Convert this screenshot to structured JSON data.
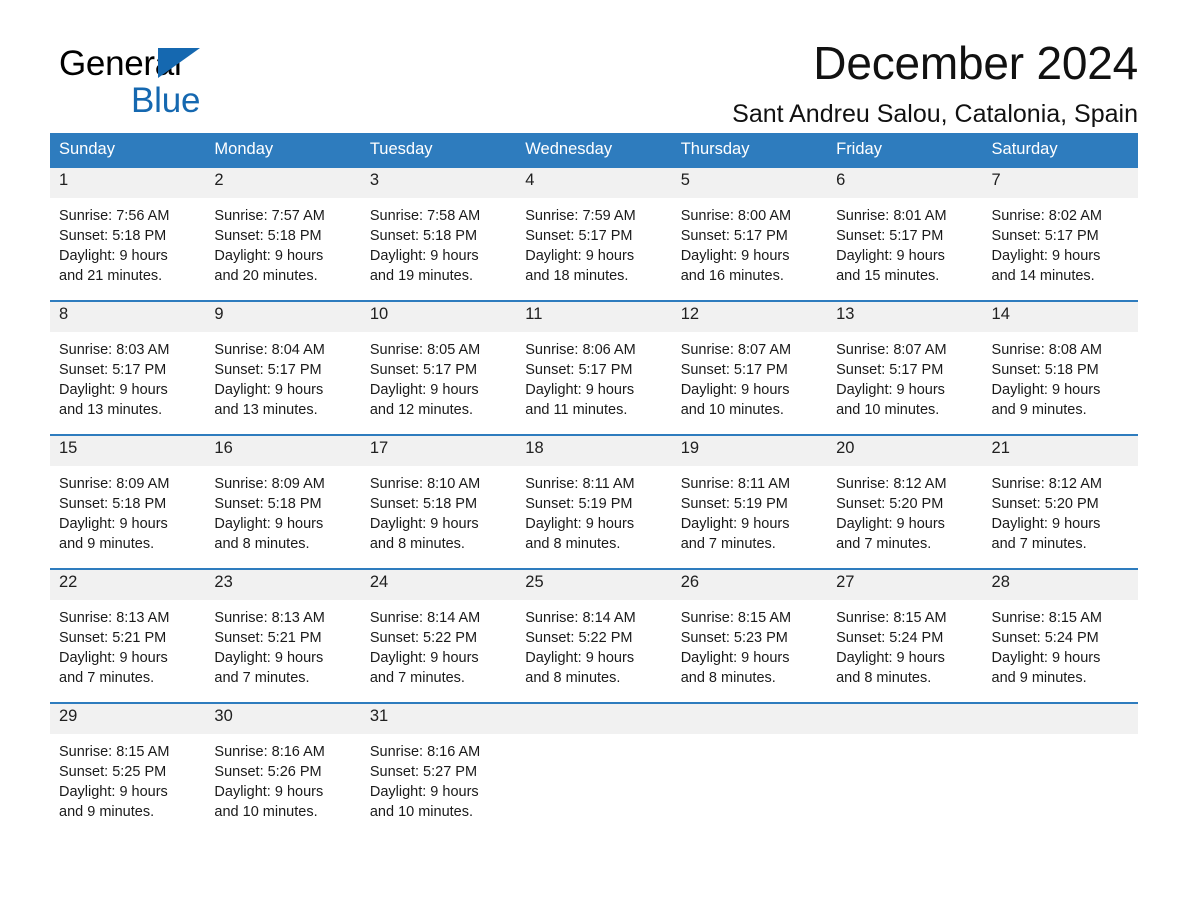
{
  "brand": {
    "name_part1": "General",
    "name_part2": "Blue",
    "accent_color": "#1568b0",
    "triangle_icon": "triangle-icon"
  },
  "header": {
    "title": "December 2024",
    "subtitle": "Sant Andreu Salou, Catalonia, Spain"
  },
  "calendar": {
    "header_bg": "#2e7cbe",
    "daynum_bg": "#f1f1f1",
    "weekday_headers": [
      "Sunday",
      "Monday",
      "Tuesday",
      "Wednesday",
      "Thursday",
      "Friday",
      "Saturday"
    ],
    "weeks": [
      [
        {
          "day": "1",
          "sunrise": "Sunrise: 7:56 AM",
          "sunset": "Sunset: 5:18 PM",
          "daylight1": "Daylight: 9 hours",
          "daylight2": "and 21 minutes."
        },
        {
          "day": "2",
          "sunrise": "Sunrise: 7:57 AM",
          "sunset": "Sunset: 5:18 PM",
          "daylight1": "Daylight: 9 hours",
          "daylight2": "and 20 minutes."
        },
        {
          "day": "3",
          "sunrise": "Sunrise: 7:58 AM",
          "sunset": "Sunset: 5:18 PM",
          "daylight1": "Daylight: 9 hours",
          "daylight2": "and 19 minutes."
        },
        {
          "day": "4",
          "sunrise": "Sunrise: 7:59 AM",
          "sunset": "Sunset: 5:17 PM",
          "daylight1": "Daylight: 9 hours",
          "daylight2": "and 18 minutes."
        },
        {
          "day": "5",
          "sunrise": "Sunrise: 8:00 AM",
          "sunset": "Sunset: 5:17 PM",
          "daylight1": "Daylight: 9 hours",
          "daylight2": "and 16 minutes."
        },
        {
          "day": "6",
          "sunrise": "Sunrise: 8:01 AM",
          "sunset": "Sunset: 5:17 PM",
          "daylight1": "Daylight: 9 hours",
          "daylight2": "and 15 minutes."
        },
        {
          "day": "7",
          "sunrise": "Sunrise: 8:02 AM",
          "sunset": "Sunset: 5:17 PM",
          "daylight1": "Daylight: 9 hours",
          "daylight2": "and 14 minutes."
        }
      ],
      [
        {
          "day": "8",
          "sunrise": "Sunrise: 8:03 AM",
          "sunset": "Sunset: 5:17 PM",
          "daylight1": "Daylight: 9 hours",
          "daylight2": "and 13 minutes."
        },
        {
          "day": "9",
          "sunrise": "Sunrise: 8:04 AM",
          "sunset": "Sunset: 5:17 PM",
          "daylight1": "Daylight: 9 hours",
          "daylight2": "and 13 minutes."
        },
        {
          "day": "10",
          "sunrise": "Sunrise: 8:05 AM",
          "sunset": "Sunset: 5:17 PM",
          "daylight1": "Daylight: 9 hours",
          "daylight2": "and 12 minutes."
        },
        {
          "day": "11",
          "sunrise": "Sunrise: 8:06 AM",
          "sunset": "Sunset: 5:17 PM",
          "daylight1": "Daylight: 9 hours",
          "daylight2": "and 11 minutes."
        },
        {
          "day": "12",
          "sunrise": "Sunrise: 8:07 AM",
          "sunset": "Sunset: 5:17 PM",
          "daylight1": "Daylight: 9 hours",
          "daylight2": "and 10 minutes."
        },
        {
          "day": "13",
          "sunrise": "Sunrise: 8:07 AM",
          "sunset": "Sunset: 5:17 PM",
          "daylight1": "Daylight: 9 hours",
          "daylight2": "and 10 minutes."
        },
        {
          "day": "14",
          "sunrise": "Sunrise: 8:08 AM",
          "sunset": "Sunset: 5:18 PM",
          "daylight1": "Daylight: 9 hours",
          "daylight2": "and 9 minutes."
        }
      ],
      [
        {
          "day": "15",
          "sunrise": "Sunrise: 8:09 AM",
          "sunset": "Sunset: 5:18 PM",
          "daylight1": "Daylight: 9 hours",
          "daylight2": "and 9 minutes."
        },
        {
          "day": "16",
          "sunrise": "Sunrise: 8:09 AM",
          "sunset": "Sunset: 5:18 PM",
          "daylight1": "Daylight: 9 hours",
          "daylight2": "and 8 minutes."
        },
        {
          "day": "17",
          "sunrise": "Sunrise: 8:10 AM",
          "sunset": "Sunset: 5:18 PM",
          "daylight1": "Daylight: 9 hours",
          "daylight2": "and 8 minutes."
        },
        {
          "day": "18",
          "sunrise": "Sunrise: 8:11 AM",
          "sunset": "Sunset: 5:19 PM",
          "daylight1": "Daylight: 9 hours",
          "daylight2": "and 8 minutes."
        },
        {
          "day": "19",
          "sunrise": "Sunrise: 8:11 AM",
          "sunset": "Sunset: 5:19 PM",
          "daylight1": "Daylight: 9 hours",
          "daylight2": "and 7 minutes."
        },
        {
          "day": "20",
          "sunrise": "Sunrise: 8:12 AM",
          "sunset": "Sunset: 5:20 PM",
          "daylight1": "Daylight: 9 hours",
          "daylight2": "and 7 minutes."
        },
        {
          "day": "21",
          "sunrise": "Sunrise: 8:12 AM",
          "sunset": "Sunset: 5:20 PM",
          "daylight1": "Daylight: 9 hours",
          "daylight2": "and 7 minutes."
        }
      ],
      [
        {
          "day": "22",
          "sunrise": "Sunrise: 8:13 AM",
          "sunset": "Sunset: 5:21 PM",
          "daylight1": "Daylight: 9 hours",
          "daylight2": "and 7 minutes."
        },
        {
          "day": "23",
          "sunrise": "Sunrise: 8:13 AM",
          "sunset": "Sunset: 5:21 PM",
          "daylight1": "Daylight: 9 hours",
          "daylight2": "and 7 minutes."
        },
        {
          "day": "24",
          "sunrise": "Sunrise: 8:14 AM",
          "sunset": "Sunset: 5:22 PM",
          "daylight1": "Daylight: 9 hours",
          "daylight2": "and 7 minutes."
        },
        {
          "day": "25",
          "sunrise": "Sunrise: 8:14 AM",
          "sunset": "Sunset: 5:22 PM",
          "daylight1": "Daylight: 9 hours",
          "daylight2": "and 8 minutes."
        },
        {
          "day": "26",
          "sunrise": "Sunrise: 8:15 AM",
          "sunset": "Sunset: 5:23 PM",
          "daylight1": "Daylight: 9 hours",
          "daylight2": "and 8 minutes."
        },
        {
          "day": "27",
          "sunrise": "Sunrise: 8:15 AM",
          "sunset": "Sunset: 5:24 PM",
          "daylight1": "Daylight: 9 hours",
          "daylight2": "and 8 minutes."
        },
        {
          "day": "28",
          "sunrise": "Sunrise: 8:15 AM",
          "sunset": "Sunset: 5:24 PM",
          "daylight1": "Daylight: 9 hours",
          "daylight2": "and 9 minutes."
        }
      ],
      [
        {
          "day": "29",
          "sunrise": "Sunrise: 8:15 AM",
          "sunset": "Sunset: 5:25 PM",
          "daylight1": "Daylight: 9 hours",
          "daylight2": "and 9 minutes."
        },
        {
          "day": "30",
          "sunrise": "Sunrise: 8:16 AM",
          "sunset": "Sunset: 5:26 PM",
          "daylight1": "Daylight: 9 hours",
          "daylight2": "and 10 minutes."
        },
        {
          "day": "31",
          "sunrise": "Sunrise: 8:16 AM",
          "sunset": "Sunset: 5:27 PM",
          "daylight1": "Daylight: 9 hours",
          "daylight2": "and 10 minutes."
        },
        {
          "day": "",
          "sunrise": "",
          "sunset": "",
          "daylight1": "",
          "daylight2": ""
        },
        {
          "day": "",
          "sunrise": "",
          "sunset": "",
          "daylight1": "",
          "daylight2": ""
        },
        {
          "day": "",
          "sunrise": "",
          "sunset": "",
          "daylight1": "",
          "daylight2": ""
        },
        {
          "day": "",
          "sunrise": "",
          "sunset": "",
          "daylight1": "",
          "daylight2": ""
        }
      ]
    ]
  }
}
